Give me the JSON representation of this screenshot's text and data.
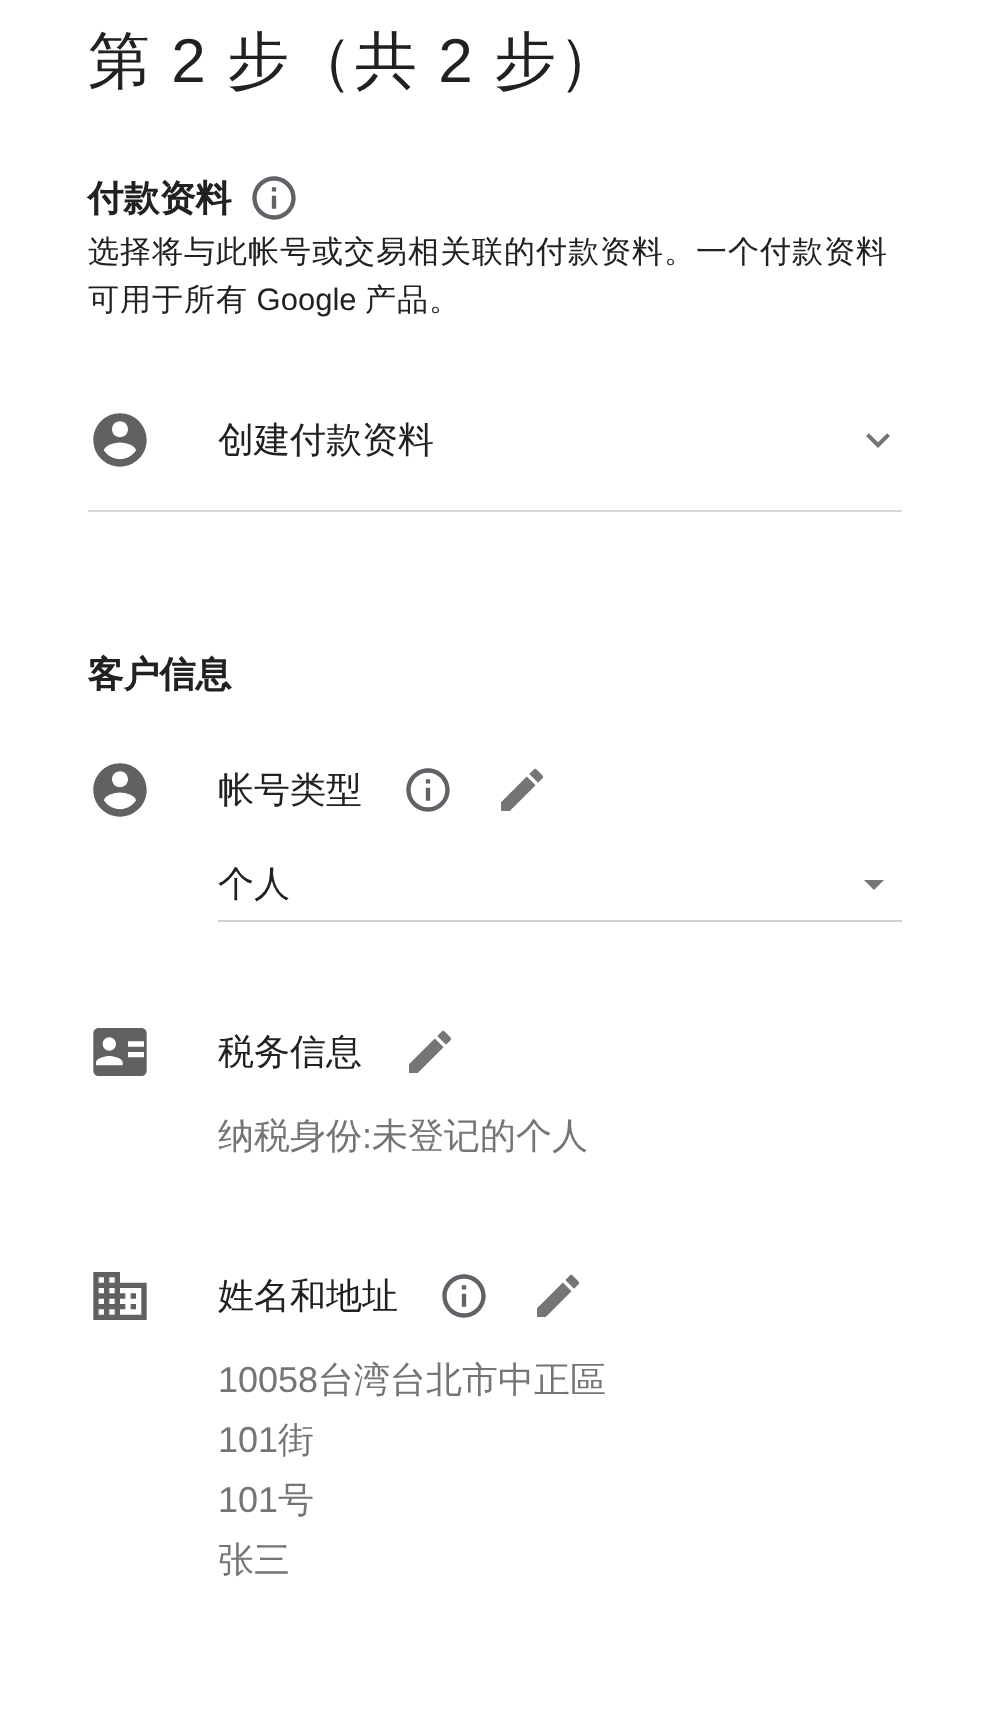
{
  "title": "第 2 步（共 2 步）",
  "payment_profile": {
    "heading": "付款资料",
    "info": true,
    "description": "选择将与此帐号或交易相关联的付款资料。一个付款资料可用于所有 Google 产品。",
    "dropdown": {
      "value": "创建付款资料"
    }
  },
  "customer_info": {
    "heading": "客户信息",
    "sections": [
      {
        "kind": "select",
        "label": "帐号类型",
        "info": true,
        "editable": true,
        "value": "个人"
      },
      {
        "kind": "text",
        "label": "税务信息",
        "info": false,
        "editable": true,
        "lines": [
          "纳税身份:未登记的个人"
        ]
      },
      {
        "kind": "text",
        "label": "姓名和地址",
        "info": true,
        "editable": true,
        "lines": [
          "10058台湾台北市中正區",
          "101街",
          "101号",
          "张三"
        ]
      }
    ]
  }
}
